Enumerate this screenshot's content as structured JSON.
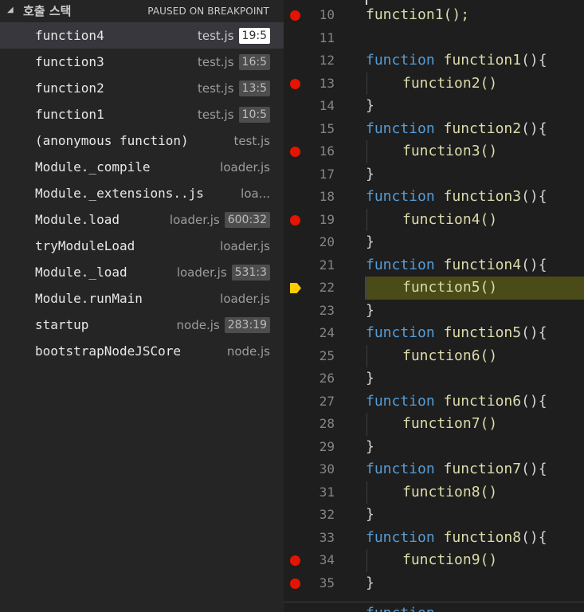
{
  "callstack": {
    "title": "호출 스택",
    "status": "PAUSED ON BREAKPOINT",
    "frames": [
      {
        "fn": "function4",
        "file": "test.js",
        "pos": "19:5",
        "selected": true
      },
      {
        "fn": "function3",
        "file": "test.js",
        "pos": "16:5"
      },
      {
        "fn": "function2",
        "file": "test.js",
        "pos": "13:5"
      },
      {
        "fn": "function1",
        "file": "test.js",
        "pos": "10:5"
      },
      {
        "fn": "(anonymous function)",
        "file": "test.js",
        "pos": ""
      },
      {
        "fn": "Module._compile",
        "file": "loader.js",
        "pos": ""
      },
      {
        "fn": "Module._extensions..js",
        "file": "loa...",
        "pos": ""
      },
      {
        "fn": "Module.load",
        "file": "loader.js",
        "pos": "600:32"
      },
      {
        "fn": "tryModuleLoad",
        "file": "loader.js",
        "pos": ""
      },
      {
        "fn": "Module._load",
        "file": "loader.js",
        "pos": "531:3"
      },
      {
        "fn": "Module.runMain",
        "file": "loader.js",
        "pos": ""
      },
      {
        "fn": "startup",
        "file": "node.js",
        "pos": "283:19"
      },
      {
        "fn": "bootstrapNodeJSCore",
        "file": "node.js",
        "pos": ""
      }
    ]
  },
  "editor": {
    "keyword": "function",
    "lines": [
      {
        "n": "10",
        "kind": "call",
        "text": "function1();",
        "bp": true
      },
      {
        "n": "11",
        "kind": "blank"
      },
      {
        "n": "12",
        "kind": "decl",
        "name": "function1",
        "tail": "(){"
      },
      {
        "n": "13",
        "kind": "body",
        "text": "function2()",
        "bp": true
      },
      {
        "n": "14",
        "kind": "close",
        "text": "}"
      },
      {
        "n": "15",
        "kind": "decl",
        "name": "function2",
        "tail": "(){"
      },
      {
        "n": "16",
        "kind": "body",
        "text": "function3()",
        "bp": true
      },
      {
        "n": "17",
        "kind": "close",
        "text": "}"
      },
      {
        "n": "18",
        "kind": "decl",
        "name": "function3",
        "tail": "(){"
      },
      {
        "n": "19",
        "kind": "body",
        "text": "function4()",
        "bp": true
      },
      {
        "n": "20",
        "kind": "close",
        "text": "}"
      },
      {
        "n": "21",
        "kind": "decl",
        "name": "function4",
        "tail": "(){"
      },
      {
        "n": "22",
        "kind": "body",
        "text": "function5()",
        "current": true
      },
      {
        "n": "23",
        "kind": "close",
        "text": "}"
      },
      {
        "n": "24",
        "kind": "decl",
        "name": "function5",
        "tail": "(){"
      },
      {
        "n": "25",
        "kind": "body",
        "text": "function6()"
      },
      {
        "n": "26",
        "kind": "close",
        "text": "}"
      },
      {
        "n": "27",
        "kind": "decl",
        "name": "function6",
        "tail": "(){"
      },
      {
        "n": "28",
        "kind": "body",
        "text": "function7()"
      },
      {
        "n": "29",
        "kind": "close",
        "text": "}"
      },
      {
        "n": "30",
        "kind": "decl",
        "name": "function7",
        "tail": "(){"
      },
      {
        "n": "31",
        "kind": "body",
        "text": "function8()"
      },
      {
        "n": "32",
        "kind": "close",
        "text": "}"
      },
      {
        "n": "33",
        "kind": "decl",
        "name": "function8",
        "tail": "(){"
      },
      {
        "n": "34",
        "kind": "body",
        "text": "function9()",
        "bp": true
      },
      {
        "n": "35",
        "kind": "close",
        "text": "}",
        "bp": true
      }
    ]
  },
  "colors": {
    "breakpoint": "#e51400",
    "current_line_arrow": "#ffcc00",
    "current_line_bg": "#4b4b18",
    "keyword": "#569cd6",
    "function_name": "#dcdcaa"
  },
  "icons": {
    "collapse": "chevron-down-icon",
    "breakpoint": "breakpoint-icon",
    "current_line": "current-line-arrow-icon"
  }
}
